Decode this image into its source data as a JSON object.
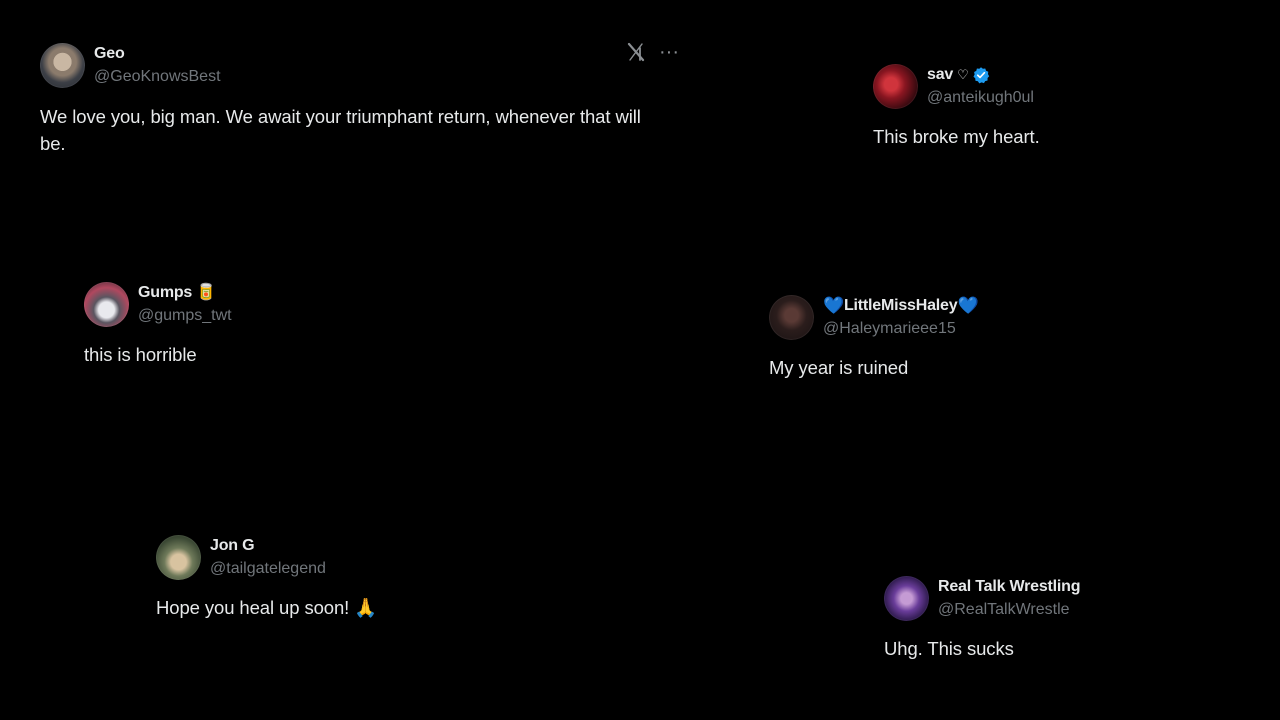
{
  "colors": {
    "background": "#000000",
    "text": "#e7e9ea",
    "handle": "#71767b",
    "verified": "#1d9bf0",
    "heart": "#5dade2"
  },
  "toolbar": {
    "logo_icon": "x-logo-icon",
    "more_icon": "more-options-icon",
    "more_label": "···"
  },
  "tweets": [
    {
      "display_name": "Geo",
      "handle": "@GeoKnowsBest",
      "text": "We love you, big man. We await your triumphant return, whenever that will be.",
      "avatar_icon": "user-avatar"
    },
    {
      "display_name": "sav",
      "name_suffix": "♡",
      "verified": true,
      "handle": "@anteikugh0ul",
      "text": "This broke my heart.",
      "avatar_icon": "user-avatar"
    },
    {
      "display_name": "Gumps",
      "name_suffix": "🥫",
      "handle": "@gumps_twt",
      "text": "this is horrible",
      "avatar_icon": "cat-avatar"
    },
    {
      "display_name": "LittleMissHaley",
      "name_prefix": "💙",
      "name_suffix": "💙",
      "handle": "@Haleymarieee15",
      "text": "My year is ruined",
      "avatar_icon": "user-avatar"
    },
    {
      "display_name": "Jon G",
      "handle": "@tailgatelegend",
      "text": "Hope you heal up soon! 🙏",
      "avatar_icon": "dog-avatar"
    },
    {
      "display_name": "Real Talk Wrestling",
      "handle": "@RealTalkWrestle",
      "text": "Uhg. This sucks",
      "avatar_icon": "user-avatar"
    }
  ]
}
